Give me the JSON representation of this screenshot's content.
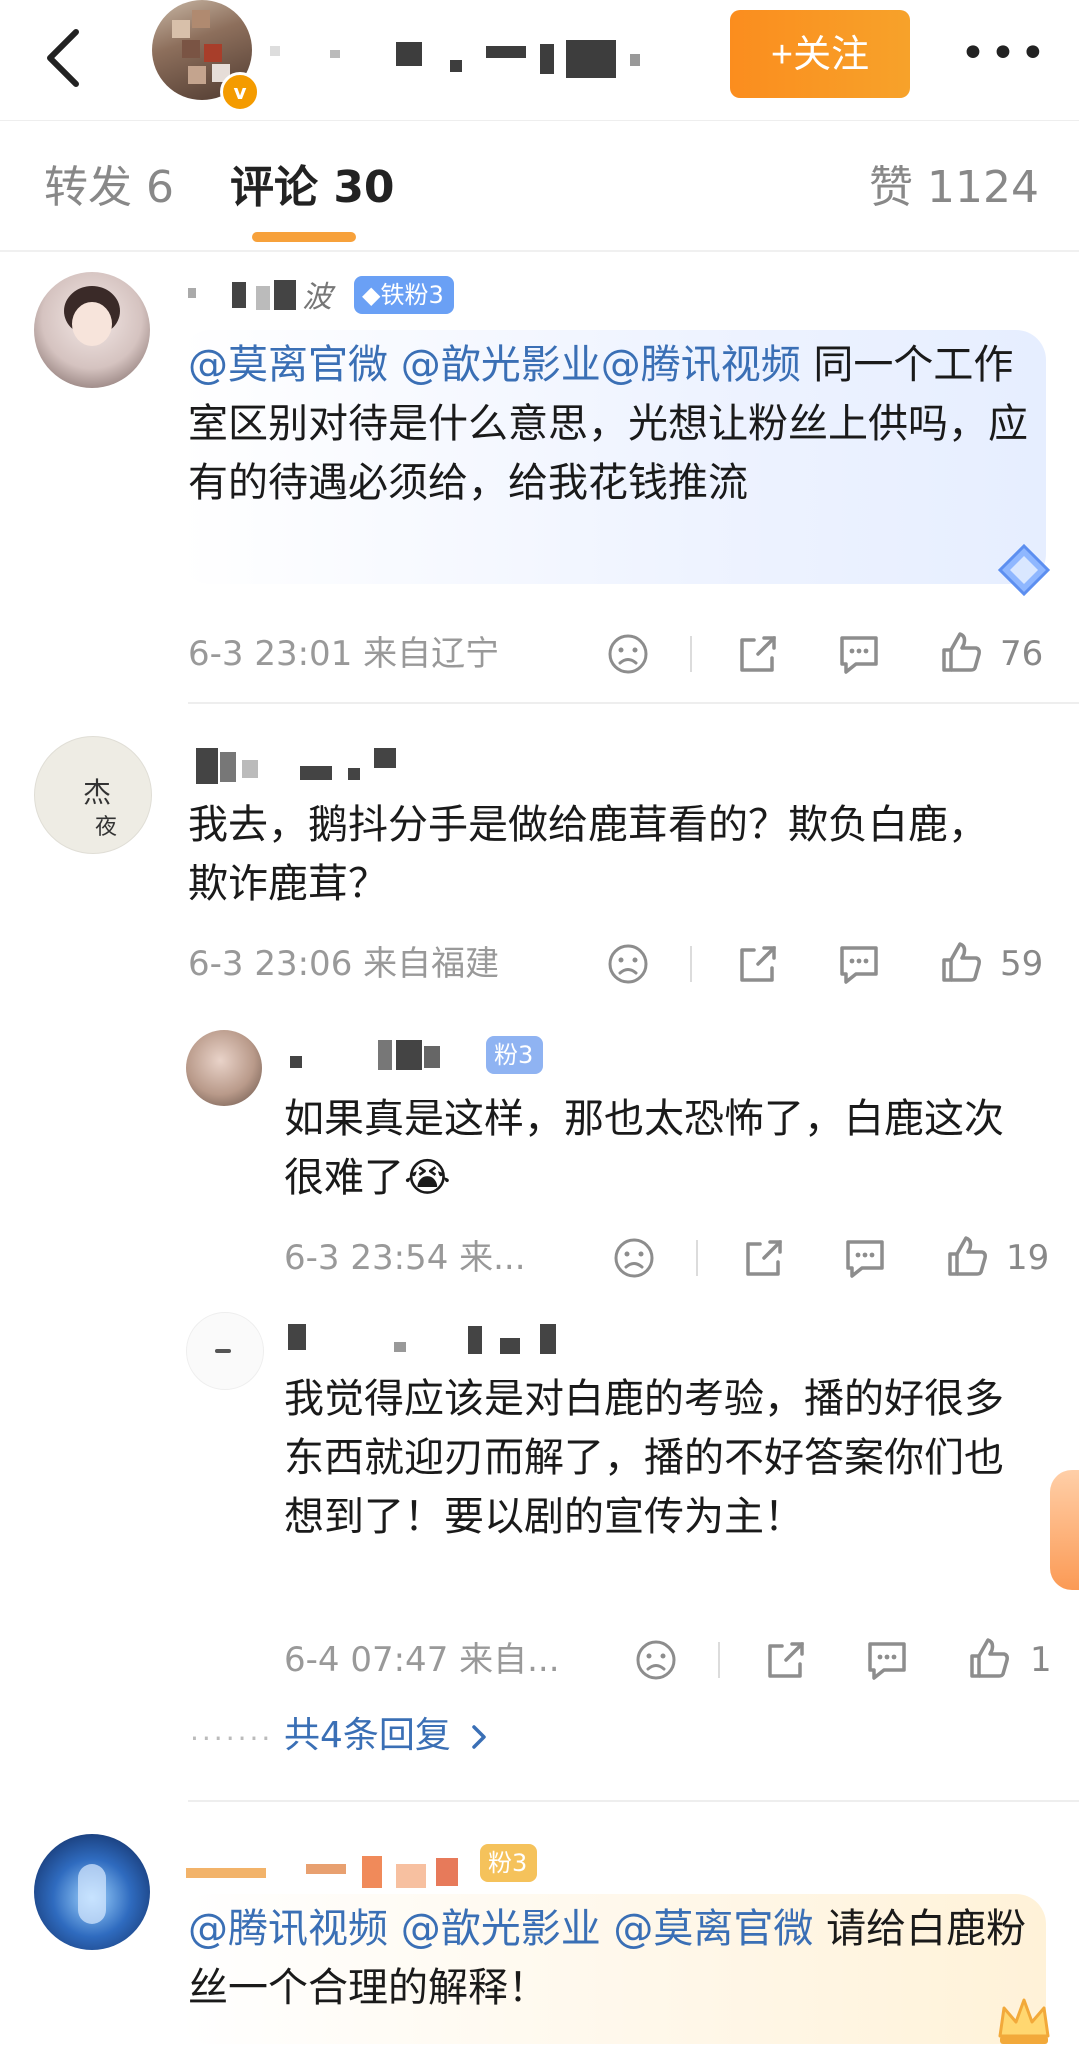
{
  "header": {
    "follow_label": "+关注",
    "more_label": "•••",
    "verified_mark": "v"
  },
  "tabs": {
    "repost": "转发 6",
    "comments": "评论 30",
    "likes": "赞 1124"
  },
  "comments": [
    {
      "user_suffix": "波",
      "badge": "铁粉3",
      "mentions": "@莫离官微 @歆光影业@腾讯视频",
      "text": " 同一个工作室区别对待是什么意思，光想让粉丝上供吗，应有的待遇必须给，给我花钱推流",
      "meta": "6-3 23:01  来自辽宁",
      "likes": "76"
    },
    {
      "text": "我去，鹅抖分手是做给鹿茸看的？欺负白鹿，欺诈鹿茸？",
      "meta": "6-3 23:06  来自福建",
      "likes": "59",
      "replies": [
        {
          "badge": "粉3",
          "text": "如果真是这样，那也太恐怖了，白鹿这次很难了😭",
          "meta": "6-3 23:54  来...",
          "likes": "19"
        },
        {
          "text": "我觉得应该是对白鹿的考验，播的好很多东西就迎刃而解了，播的不好答案你们也想到了！要以剧的宣传为主！",
          "meta": "6-4 07:47  来自...",
          "likes": "1"
        }
      ],
      "more_replies": "共4条回复",
      "dots": "·······"
    },
    {
      "badge": "粉3",
      "mentions": "@腾讯视频 @歆光影业 @莫离官微",
      "text": " 请给白鹿粉丝一个合理的解释！"
    }
  ],
  "colors": {
    "accent_orange": "#f7a13b",
    "follow_button": "#fb8d1e",
    "mention_blue": "#3a6fb5",
    "badge_blue": "#6aa0f5"
  },
  "icons": [
    "back-arrow-icon",
    "verified-icon",
    "more-icon",
    "dislike-icon",
    "share-icon",
    "comment-icon",
    "like-icon",
    "chevron-right-icon",
    "diamond-icon"
  ]
}
